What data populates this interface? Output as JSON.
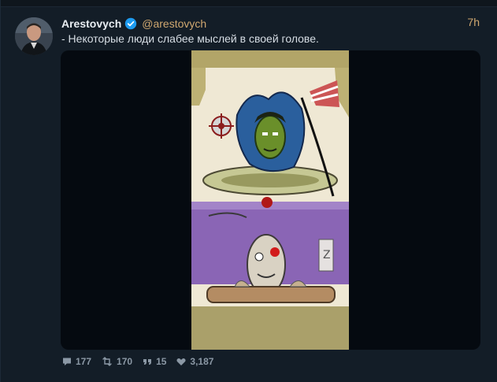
{
  "tweet": {
    "author_name": "Arestovych",
    "author_handle": "@arestovych",
    "time": "7h",
    "text": "- Некоторые люди слабее мыслей в своей голове.",
    "verified": true
  },
  "actions": {
    "replies": "177",
    "retweets": "170",
    "quotes": "15",
    "likes": "3,187"
  },
  "icons": {
    "reply": "speech-bubble-icon",
    "retweet": "retweet-icon",
    "quote": "quote-icon",
    "like": "heart-icon",
    "verified": "verified-badge-icon"
  },
  "colors": {
    "background": "#131d27",
    "name": "#e8edf2",
    "handle": "#d0a870",
    "text": "#d6dde4",
    "action": "#8b98a5",
    "verified": "#1d9bf0"
  }
}
